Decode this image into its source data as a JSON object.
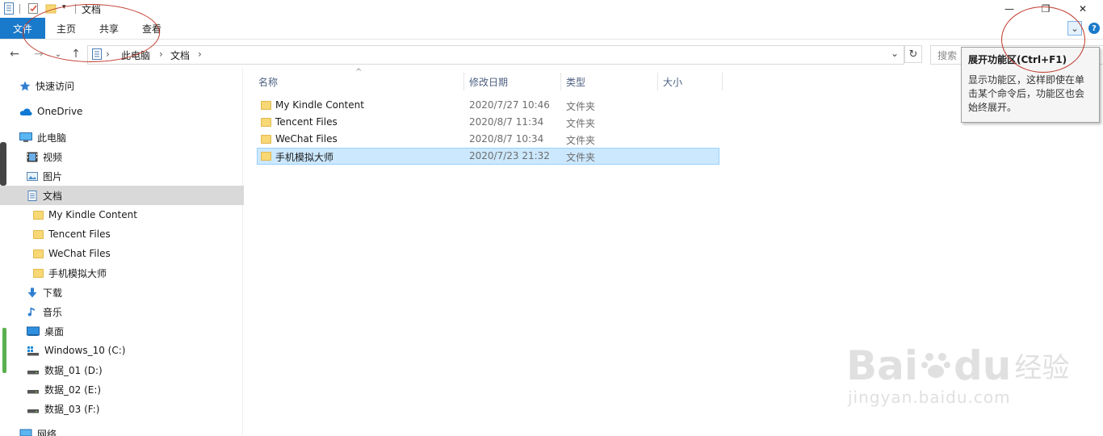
{
  "window": {
    "title": "文档",
    "minimize_glyph": "—",
    "restore_glyph": "❐",
    "close_glyph": "✕"
  },
  "ribbon": {
    "tabs": [
      {
        "label": "文件",
        "active": true
      },
      {
        "label": "主页"
      },
      {
        "label": "共享"
      },
      {
        "label": "查看"
      }
    ],
    "expand_glyph": "⌄",
    "help_glyph": "?"
  },
  "address": {
    "crumbs": [
      "此电脑",
      "文档"
    ],
    "separator": "›",
    "dropdown_glyph": "⌄",
    "refresh_glyph": "↻",
    "search_placeholder": "搜索"
  },
  "nav_glyphs": {
    "back": "←",
    "forward": "→",
    "history": "⌄",
    "up": "↑"
  },
  "sidebar": {
    "items": [
      {
        "label": "快速访问",
        "icon": "star-icon"
      },
      {
        "label": "OneDrive",
        "icon": "cloud-icon"
      },
      {
        "label": "此电脑",
        "icon": "computer-icon"
      },
      {
        "label": "视频",
        "icon": "video-icon"
      },
      {
        "label": "图片",
        "icon": "picture-icon"
      },
      {
        "label": "文档",
        "icon": "document-icon",
        "selected": true
      },
      {
        "label": "My Kindle Content",
        "icon": "folder-icon"
      },
      {
        "label": "Tencent Files",
        "icon": "folder-icon"
      },
      {
        "label": "WeChat Files",
        "icon": "folder-icon"
      },
      {
        "label": "手机模拟大师",
        "icon": "folder-icon"
      },
      {
        "label": "下载",
        "icon": "download-icon"
      },
      {
        "label": "音乐",
        "icon": "music-icon"
      },
      {
        "label": "桌面",
        "icon": "desktop-icon"
      },
      {
        "label": "Windows_10 (C:)",
        "icon": "system-drive-icon"
      },
      {
        "label": "数据_01 (D:)",
        "icon": "drive-icon"
      },
      {
        "label": "数据_02 (E:)",
        "icon": "drive-icon"
      },
      {
        "label": "数据_03 (F:)",
        "icon": "drive-icon"
      },
      {
        "label": "网络",
        "icon": "network-icon"
      }
    ]
  },
  "file_list": {
    "sort_glyph": "^",
    "columns": [
      "名称",
      "修改日期",
      "类型",
      "大小"
    ],
    "rows": [
      {
        "name": "My Kindle Content",
        "date": "2020/7/27 10:46",
        "type": "文件夹",
        "size": ""
      },
      {
        "name": "Tencent Files",
        "date": "2020/8/7 11:34",
        "type": "文件夹",
        "size": ""
      },
      {
        "name": "WeChat Files",
        "date": "2020/8/7 10:34",
        "type": "文件夹",
        "size": ""
      },
      {
        "name": "手机模拟大师",
        "date": "2020/7/23 21:32",
        "type": "文件夹",
        "size": "",
        "selected": true
      }
    ]
  },
  "tooltip": {
    "title": "展开功能区(Ctrl+F1)",
    "lines": [
      "显示功能区，这样即使在单",
      "击某个命令后，功能区也会",
      "始终展开。"
    ]
  },
  "watermark": {
    "brand": "Bai",
    "brand_suffix": "du",
    "cn": "经验",
    "url": "jingyan.baidu.com"
  },
  "colors": {
    "accent": "#1979ca",
    "selection": "#cce8ff",
    "annotation": "#c0392b"
  }
}
